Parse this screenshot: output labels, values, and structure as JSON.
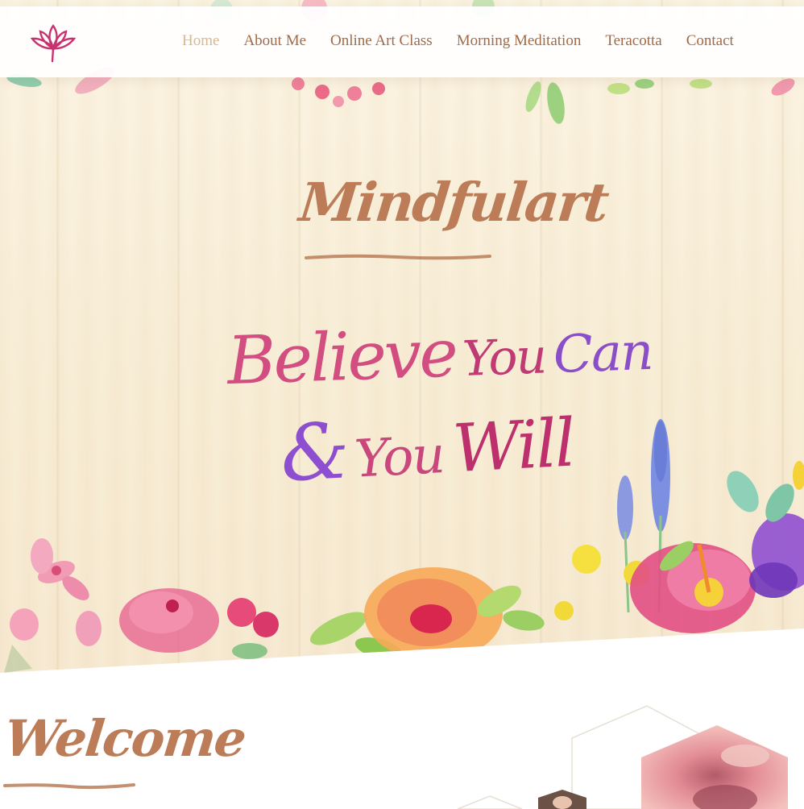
{
  "nav": {
    "items": [
      {
        "label": "Home",
        "active": true
      },
      {
        "label": "About Me",
        "active": false
      },
      {
        "label": "Online Art Class",
        "active": false
      },
      {
        "label": "Morning Meditation",
        "active": false
      },
      {
        "label": "Teracotta",
        "active": false
      },
      {
        "label": "Contact",
        "active": false
      }
    ],
    "logo_icon": "lotus-icon"
  },
  "hero": {
    "title": "Mindfulart",
    "tagline": {
      "word1": "Believe",
      "word2": "You",
      "word3": "Can",
      "word4": "&",
      "word5": "You",
      "word6": "Will"
    }
  },
  "welcome": {
    "heading": "Welcome"
  },
  "colors": {
    "accent_brown": "#bb7c57",
    "nav_text": "#a26a46",
    "nav_active": "#d9b88d",
    "logo_pink": "#c8336f",
    "tagline_pink": "#d24d80",
    "tagline_purple": "#8a4fc8",
    "hero_bg": "#f7ecd4"
  }
}
